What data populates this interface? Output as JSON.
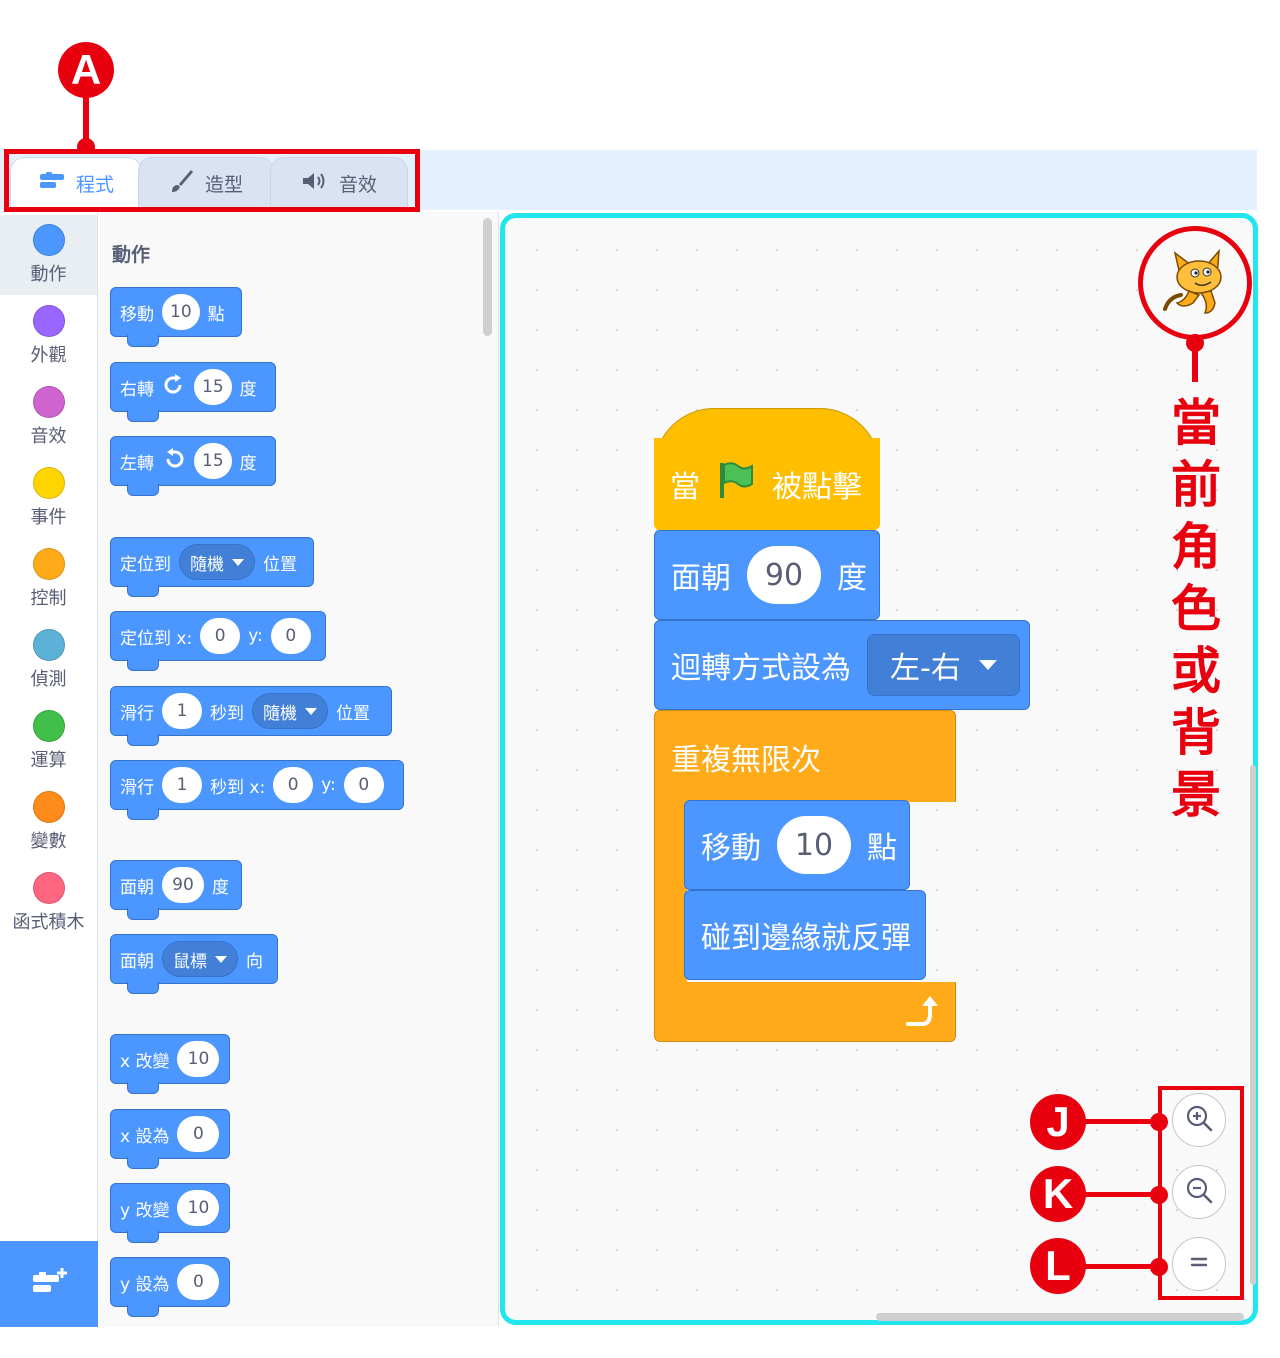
{
  "annotations": {
    "tabs_marker": "A",
    "sprite_label": "當前角色或背景",
    "zoom_in_marker": "J",
    "zoom_out_marker": "K",
    "zoom_reset_marker": "L"
  },
  "tabs": [
    {
      "label": "程式",
      "icon": "code-icon",
      "active": true
    },
    {
      "label": "造型",
      "icon": "brush-icon",
      "active": false
    },
    {
      "label": "音效",
      "icon": "speaker-icon",
      "active": false
    }
  ],
  "categories": [
    {
      "label": "動作",
      "color": "#4c97ff"
    },
    {
      "label": "外觀",
      "color": "#9966ff"
    },
    {
      "label": "音效",
      "color": "#cf63cf"
    },
    {
      "label": "事件",
      "color": "#ffd500"
    },
    {
      "label": "控制",
      "color": "#ffab19"
    },
    {
      "label": "偵測",
      "color": "#5cb1d6"
    },
    {
      "label": "運算",
      "color": "#40bf4a"
    },
    {
      "label": "變數",
      "color": "#ff8c1a"
    },
    {
      "label": "函式積木",
      "color": "#ff6680"
    }
  ],
  "palette": {
    "title": "動作",
    "move": {
      "label": "移動",
      "value": "10",
      "unit": "點"
    },
    "turn_right": {
      "label": "右轉",
      "value": "15",
      "unit": "度"
    },
    "turn_left": {
      "label": "左轉",
      "value": "15",
      "unit": "度"
    },
    "goto_random": {
      "label": "定位到",
      "option": "隨機",
      "unit": "位置"
    },
    "goto_xy": {
      "label": "定位到 x:",
      "x": "0",
      "ylabel": "y:",
      "y": "0"
    },
    "glide_random": {
      "label": "滑行",
      "secs": "1",
      "mid": "秒到",
      "option": "隨機",
      "unit": "位置"
    },
    "glide_xy": {
      "label": "滑行",
      "secs": "1",
      "mid": "秒到 x:",
      "x": "0",
      "ylabel": "y:",
      "y": "0"
    },
    "point_dir": {
      "label": "面朝",
      "value": "90",
      "unit": "度"
    },
    "point_towards": {
      "label": "面朝",
      "option": "鼠標",
      "unit": "向"
    },
    "change_x": {
      "label": "x 改變",
      "value": "10"
    },
    "set_x": {
      "label": "x 設為",
      "value": "0"
    },
    "change_y": {
      "label": "y 改變",
      "value": "10"
    },
    "set_y": {
      "label": "y 設為",
      "value": "0"
    }
  },
  "script": {
    "hat": {
      "pre": "當",
      "post": "被點擊"
    },
    "point": {
      "label": "面朝",
      "value": "90",
      "unit": "度"
    },
    "rotation": {
      "label": "迴轉方式設為",
      "option": "左-右"
    },
    "forever": {
      "label": "重複無限次"
    },
    "move": {
      "label": "移動",
      "value": "10",
      "unit": "點"
    },
    "bounce": {
      "label": "碰到邊緣就反彈"
    }
  },
  "colors": {
    "motion": "#4c97ff",
    "events": "#ffbf00",
    "control": "#ffab19",
    "annotation": "#e8000f",
    "workspace_highlight": "#22e6ee"
  }
}
